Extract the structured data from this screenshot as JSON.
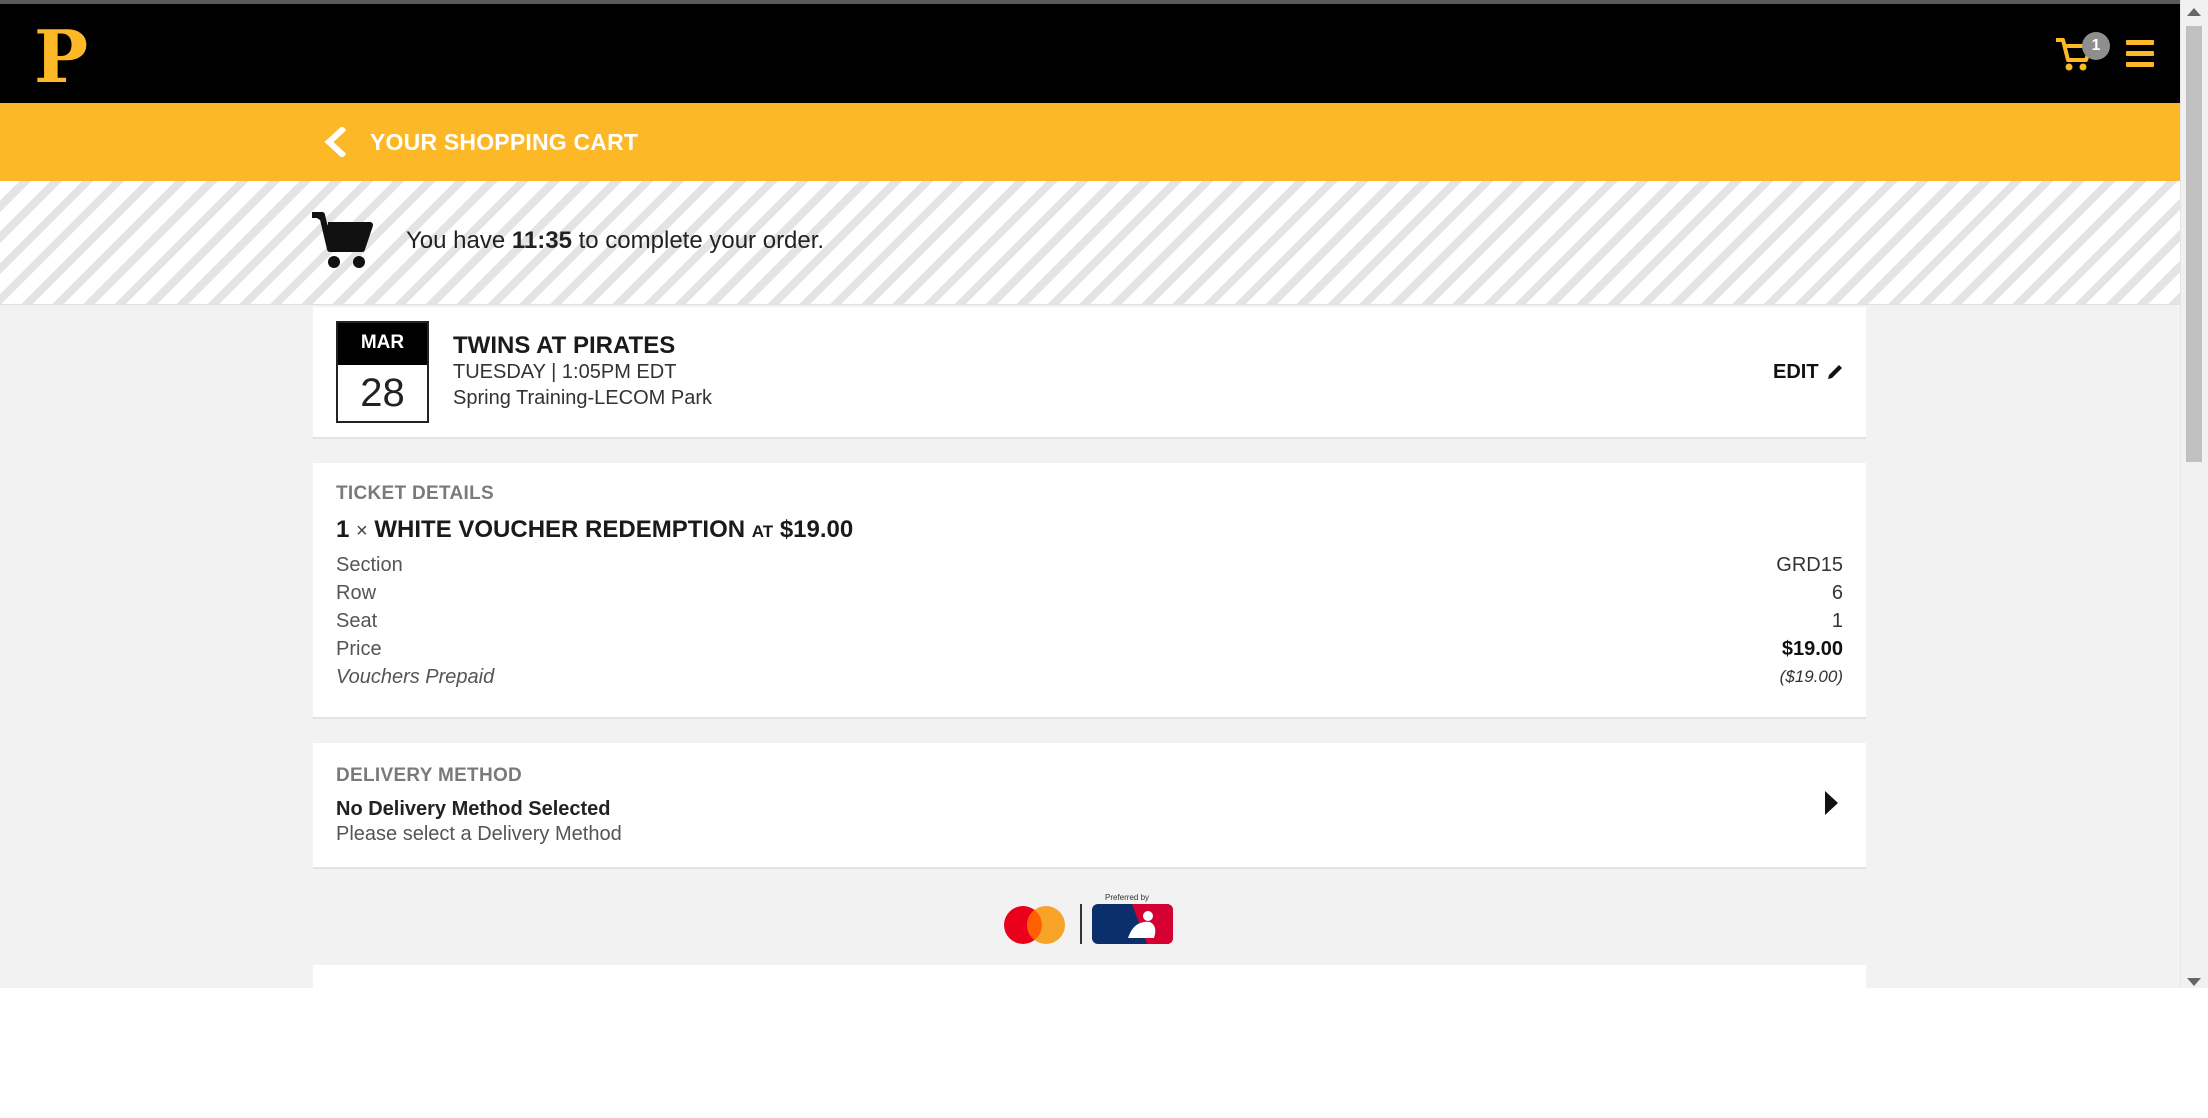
{
  "header": {
    "logo_letter": "P",
    "cart_count": "1",
    "brand_color": "#fdb827",
    "bar_color": "#000000"
  },
  "cart_bar": {
    "title": "YOUR SHOPPING CART"
  },
  "timer": {
    "prefix": "You have",
    "time": "11:35",
    "suffix": "to complete your order."
  },
  "event": {
    "month": "MAR",
    "day": "28",
    "title": "TWINS AT PIRATES",
    "datetime": "TUESDAY | 1:05PM EDT",
    "venue": "Spring Training-LECOM Park",
    "edit_label": "EDIT"
  },
  "ticket": {
    "section_label": "TICKET DETAILS",
    "quantity": "1",
    "times": "×",
    "name": "WHITE VOUCHER REDEMPTION",
    "at": "AT",
    "price": "$19.00",
    "rows": [
      {
        "label": "Section",
        "value": "GRD15"
      },
      {
        "label": "Row",
        "value": "6"
      },
      {
        "label": "Seat",
        "value": "1"
      },
      {
        "label": "Price",
        "value": "$19.00"
      },
      {
        "label": "Vouchers Prepaid",
        "value": "($19.00)"
      }
    ]
  },
  "delivery": {
    "section_label": "DELIVERY METHOD",
    "title": "No Delivery Method Selected",
    "subtitle": "Please select a Delivery Method"
  },
  "sponsors": {
    "caption": "Preferred by"
  }
}
